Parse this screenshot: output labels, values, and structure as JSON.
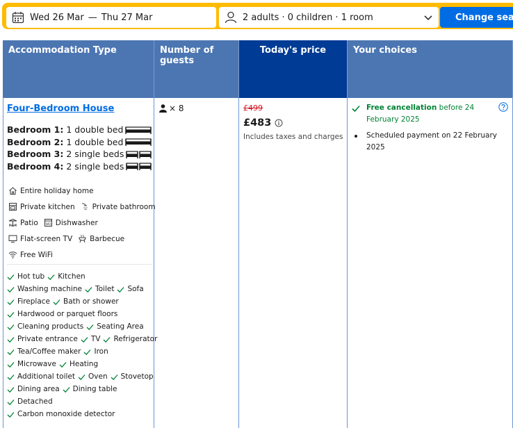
{
  "search": {
    "checkin": "Wed 26 Mar",
    "dash": "—",
    "checkout": "Thu 27 Mar",
    "occupancy": "2 adults · 0 children · 1 room",
    "button": "Change search"
  },
  "table": {
    "headers": [
      "Accommodation Type",
      "Number of guests",
      "Today's price",
      "Your choices"
    ]
  },
  "room": {
    "name": "Four-Bedroom House",
    "beds": [
      {
        "label": "Bedroom 1:",
        "desc": "1 double bed",
        "icons": "double"
      },
      {
        "label": "Bedroom 2:",
        "desc": "1 double bed",
        "icons": "double"
      },
      {
        "label": "Bedroom 3:",
        "desc": "2 single beds",
        "icons": "single"
      },
      {
        "label": "Bedroom 4:",
        "desc": "2 single beds",
        "icons": "single"
      }
    ],
    "facilities": [
      [
        {
          "icon": "home-icon",
          "label": "Entire holiday home"
        }
      ],
      [
        {
          "icon": "kitchen-icon",
          "label": "Private kitchen"
        },
        {
          "icon": "shower-icon",
          "label": "Private bathroom"
        }
      ],
      [
        {
          "icon": "patio-icon",
          "label": "Patio"
        },
        {
          "icon": "dishwasher-icon",
          "label": "Dishwasher"
        }
      ],
      [
        {
          "icon": "tv-icon",
          "label": "Flat-screen TV"
        },
        {
          "icon": "barbecue-icon",
          "label": "Barbecue"
        }
      ],
      [
        {
          "icon": "wifi-icon",
          "label": "Free WiFi"
        }
      ]
    ],
    "amenities": [
      [
        "Hot tub",
        "Kitchen"
      ],
      [
        "Washing machine",
        "Toilet",
        "Sofa"
      ],
      [
        "Fireplace",
        "Bath or shower"
      ],
      [
        "Hardwood or parquet floors"
      ],
      [
        "Cleaning products",
        "Seating Area"
      ],
      [
        "Private entrance",
        "TV",
        "Refrigerator"
      ],
      [
        "Tea/Coffee maker",
        "Iron"
      ],
      [
        "Microwave",
        "Heating"
      ],
      [
        "Additional toilet",
        "Oven",
        "Stovetop"
      ],
      [
        "Dining area",
        "Dining table"
      ],
      [
        "Detached"
      ],
      [
        "Carbon monoxide detector"
      ]
    ]
  },
  "guests": {
    "multiplier": "× 8"
  },
  "price": {
    "original": "£499",
    "current": "£483",
    "note": "Includes taxes and charges"
  },
  "choices": {
    "cancel_label": "Free cancellation",
    "cancel_rest": " before 24 February 2025",
    "payment": "Scheduled payment on 22 February 2025"
  },
  "colors": {
    "header": "#4c76b2",
    "price_header": "#003b95",
    "search_border": "#febb02",
    "button": "#006ce4",
    "green": "#008234",
    "strike": "#d4111e"
  }
}
